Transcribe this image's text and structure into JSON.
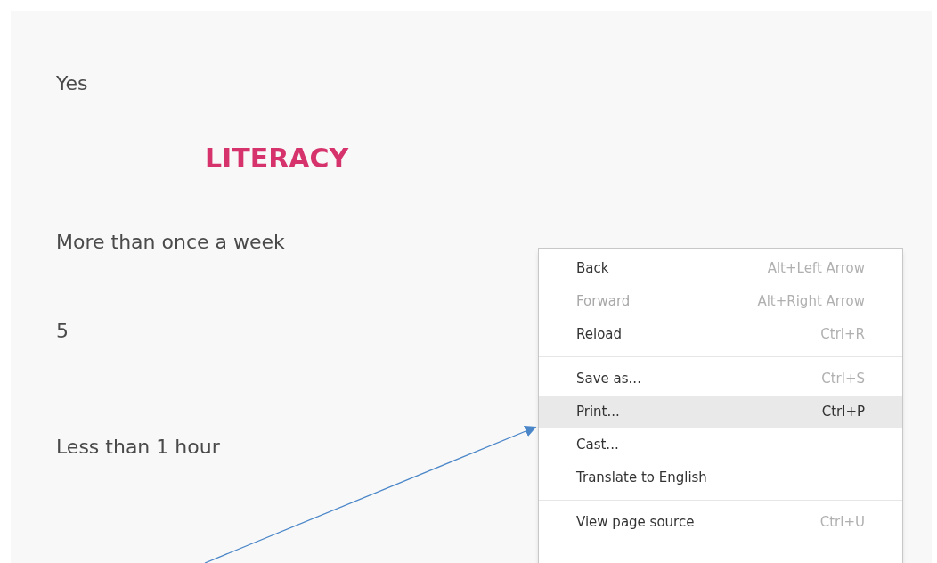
{
  "answers": [
    {
      "kind": "answer",
      "text": "Yes"
    },
    {
      "kind": "heading",
      "text": "LITERACY"
    },
    {
      "kind": "answer",
      "text": "More than once a week"
    },
    {
      "kind": "answer",
      "text": "5"
    },
    {
      "kind": "answer",
      "text": "Less than 1 hour"
    }
  ],
  "context_menu": [
    {
      "kind": "item",
      "label": "Back",
      "shortcut": "Alt+Left Arrow",
      "disabled": false,
      "selected": false
    },
    {
      "kind": "item",
      "label": "Forward",
      "shortcut": "Alt+Right Arrow",
      "disabled": true,
      "selected": false
    },
    {
      "kind": "item",
      "label": "Reload",
      "shortcut": "Ctrl+R",
      "disabled": false,
      "selected": false
    },
    {
      "kind": "separator"
    },
    {
      "kind": "item",
      "label": "Save as...",
      "shortcut": "Ctrl+S",
      "disabled": false,
      "selected": false
    },
    {
      "kind": "item",
      "label": "Print...",
      "shortcut": "Ctrl+P",
      "disabled": false,
      "selected": true
    },
    {
      "kind": "item",
      "label": "Cast...",
      "disabled": false,
      "selected": false
    },
    {
      "kind": "item",
      "label": "Translate to English",
      "disabled": false,
      "selected": false
    },
    {
      "kind": "separator"
    },
    {
      "kind": "item",
      "label": "View page source",
      "shortcut": "Ctrl+U",
      "disabled": false,
      "selected": false
    }
  ]
}
